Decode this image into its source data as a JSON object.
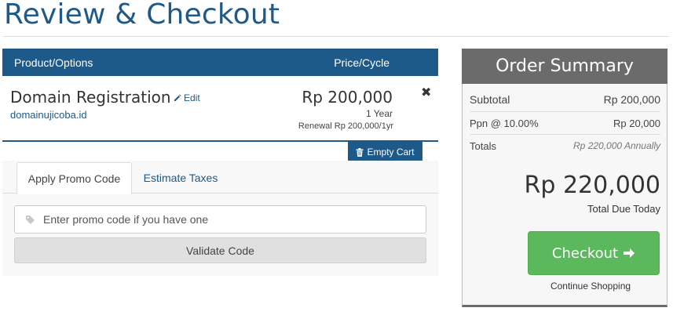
{
  "page": {
    "title": "Review & Checkout"
  },
  "cart": {
    "header": {
      "product": "Product/Options",
      "price": "Price/Cycle"
    },
    "item": {
      "name": "Domain Registration",
      "edit_label": "Edit",
      "domain": "domainujicoba.id",
      "price": "Rp 200,000",
      "cycle": "1 Year",
      "renewal": "Renewal Rp 200,000/1yr",
      "remove_glyph": "✖"
    },
    "empty_cart_label": "Empty Cart"
  },
  "promo": {
    "tabs": [
      {
        "label": "Apply Promo Code",
        "active": true
      },
      {
        "label": "Estimate Taxes",
        "active": false
      }
    ],
    "input_placeholder": "Enter promo code if you have one",
    "validate_label": "Validate Code"
  },
  "summary": {
    "title": "Order Summary",
    "subtotal_label": "Subtotal",
    "subtotal_value": "Rp 200,000",
    "tax_label": "Ppn @ 10.00%",
    "tax_value": "Rp 20,000",
    "totals_label": "Totals",
    "totals_value": "Rp 220,000 Annually",
    "grand_total": "Rp 220,000",
    "total_due_label": "Total Due Today",
    "checkout_label": "Checkout",
    "continue_label": "Continue Shopping"
  },
  "colors": {
    "primary": "#1d5a8a",
    "summary_header": "#6b6b6b",
    "checkout": "#5cb85c"
  },
  "icons": [
    "pencil-icon",
    "remove-icon",
    "trash-icon",
    "tag-icon",
    "arrow-right-icon"
  ]
}
